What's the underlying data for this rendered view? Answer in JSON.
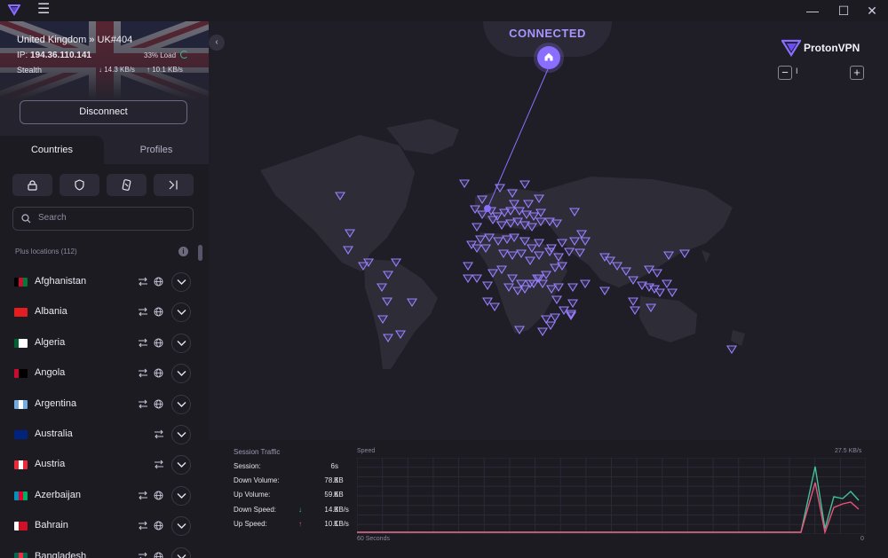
{
  "titlebar": {
    "menu_icon": "hamburger-icon",
    "min": "—",
    "max": "☐",
    "close": "✕"
  },
  "connection": {
    "server": "United Kingdom » UK#404",
    "ip_label": "IP:",
    "ip": "194.36.110.141",
    "load": "33% Load",
    "load_value": 0.33,
    "protocol": "Stealth",
    "download": "14.3 KB/s",
    "upload": "10.1 KB/s",
    "disconnect_label": "Disconnect"
  },
  "tabs": {
    "countries": "Countries",
    "profiles": "Profiles"
  },
  "search": {
    "placeholder": "Search"
  },
  "locations_label": "Plus locations (112)",
  "countries": [
    {
      "name": "Afghanistan",
      "colors": [
        "#000000",
        "#c8102e",
        "#007a36"
      ],
      "globe": true
    },
    {
      "name": "Albania",
      "colors": [
        "#e41e20",
        "#e41e20",
        "#e41e20"
      ],
      "globe": true
    },
    {
      "name": "Algeria",
      "colors": [
        "#006233",
        "#ffffff",
        "#ffffff"
      ],
      "globe": true
    },
    {
      "name": "Angola",
      "colors": [
        "#cc092f",
        "#000000",
        "#000000"
      ],
      "globe": true
    },
    {
      "name": "Argentina",
      "colors": [
        "#74acdf",
        "#ffffff",
        "#74acdf"
      ],
      "globe": true
    },
    {
      "name": "Australia",
      "colors": [
        "#00247d",
        "#00247d",
        "#00247d"
      ],
      "globe": false
    },
    {
      "name": "Austria",
      "colors": [
        "#ed2939",
        "#ffffff",
        "#ed2939"
      ],
      "globe": false
    },
    {
      "name": "Azerbaijan",
      "colors": [
        "#0092bc",
        "#e4002b",
        "#00af66"
      ],
      "globe": true
    },
    {
      "name": "Bahrain",
      "colors": [
        "#ffffff",
        "#ce1126",
        "#ce1126"
      ],
      "globe": true
    },
    {
      "name": "Bangladesh",
      "colors": [
        "#006a4e",
        "#f42a41",
        "#006a4e"
      ],
      "globe": true
    }
  ],
  "map": {
    "status": "CONNECTED",
    "brand": "ProtonVPN",
    "zoom_minus": "−",
    "zoom_plus": "+",
    "zoom_level": "I",
    "accent": "#8a6eff"
  },
  "traffic": {
    "title": "Session Traffic",
    "rows": [
      {
        "label": "Session:",
        "value": "6s",
        "unit": "",
        "arrow": ""
      },
      {
        "label": "Down Volume:",
        "value": "78.3",
        "unit": "KB",
        "arrow": ""
      },
      {
        "label": "Up Volume:",
        "value": "59.6",
        "unit": "KB",
        "arrow": ""
      },
      {
        "label": "Down Speed:",
        "value": "14.3",
        "unit": "KB/s",
        "arrow": "↓"
      },
      {
        "label": "Up Speed:",
        "value": "10.1",
        "unit": "KB/s",
        "arrow": "↑"
      }
    ],
    "speed_label": "Speed",
    "speed_max": "27.5 KB/s",
    "x_left": "60 Seconds",
    "x_right": "0",
    "down_color": "#3fc19a",
    "up_color": "#e8557a"
  }
}
